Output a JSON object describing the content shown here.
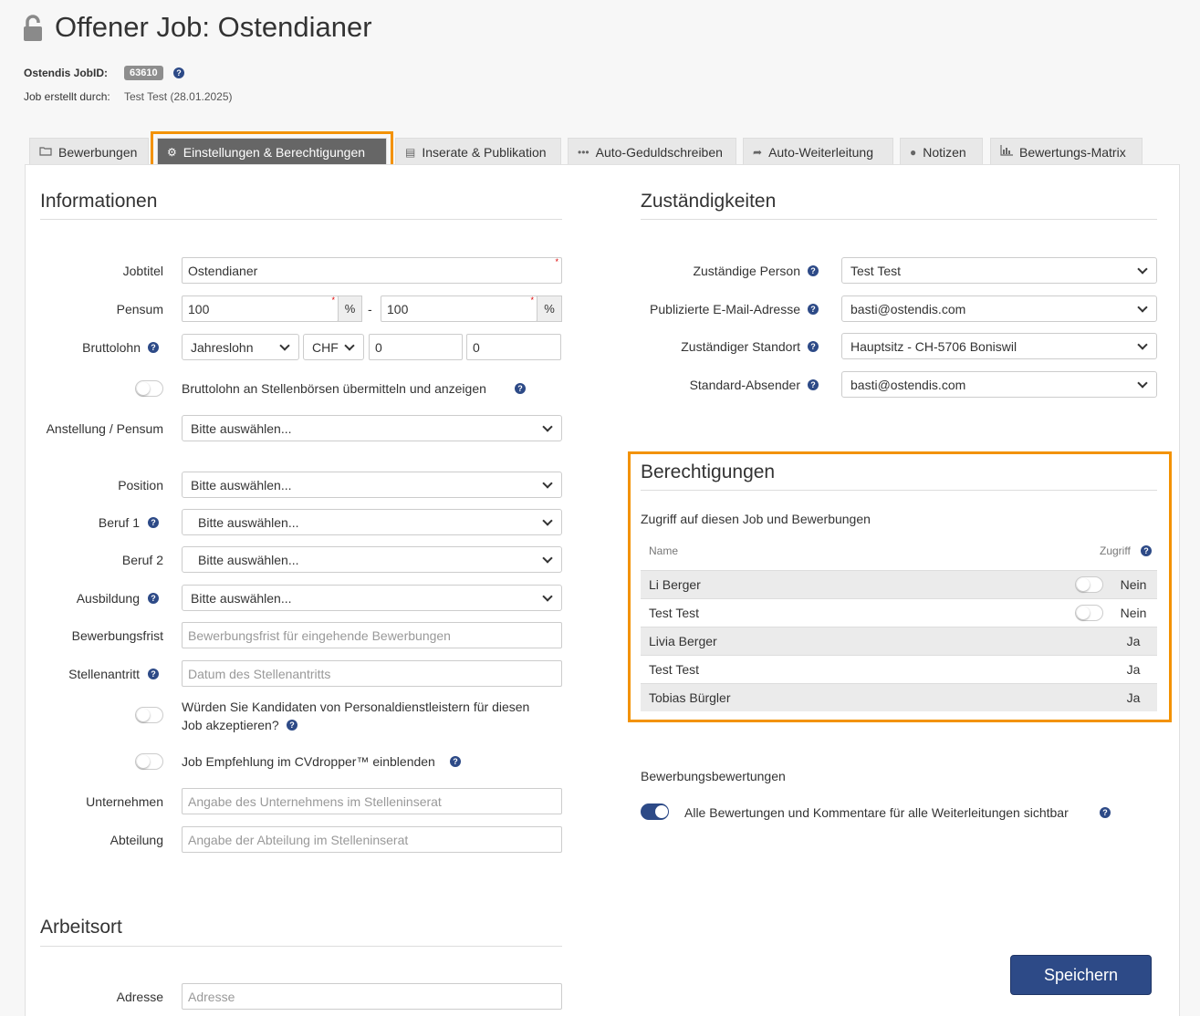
{
  "header": {
    "title": "Offener Job: Ostendianer",
    "jobid_label": "Ostendis JobID:",
    "jobid_value": "63610",
    "created_label": "Job erstellt durch:",
    "created_value": "Test Test (28.01.2025)"
  },
  "tabs": [
    {
      "label": "Bewerbungen",
      "icon": "folder-icon"
    },
    {
      "label": "Einstellungen & Berechtigungen",
      "icon": "gears-icon",
      "active": true
    },
    {
      "label": "Inserate & Publikation",
      "icon": "list-icon"
    },
    {
      "label": "Auto-Geduldschreiben",
      "icon": "dots-icon"
    },
    {
      "label": "Auto-Weiterleitung",
      "icon": "share-icon"
    },
    {
      "label": "Notizen",
      "icon": "comment-icon"
    },
    {
      "label": "Bewertungs-Matrix",
      "icon": "bar-chart-icon"
    }
  ],
  "info": {
    "title": "Informationen",
    "jobtitel_label": "Jobtitel",
    "jobtitel_value": "Ostendianer",
    "pensum_label": "Pensum",
    "pensum_from": "100",
    "pensum_to": "100",
    "percent": "%",
    "dash": "-",
    "brutto_label": "Bruttolohn",
    "brutto_type": "Jahreslohn",
    "brutto_currency": "CHF",
    "brutto_from": "0",
    "brutto_to": "0",
    "brutto_toggle_label": "Bruttolohn an Stellenbörsen übermitteln und anzeigen",
    "anstellung_label": "Anstellung / Pensum",
    "anstellung_value": "Bitte auswählen...",
    "position_label": "Position",
    "position_value": "Bitte auswählen...",
    "beruf1_label": "Beruf 1",
    "beruf1_value": "Bitte auswählen...",
    "beruf2_label": "Beruf 2",
    "beruf2_value": "Bitte auswählen...",
    "ausbildung_label": "Ausbildung",
    "ausbildung_value": "Bitte auswählen...",
    "frist_label": "Bewerbungsfrist",
    "frist_placeholder": "Bewerbungsfrist für eingehende Bewerbungen",
    "antritt_label": "Stellenantritt",
    "antritt_placeholder": "Datum des Stellenantritts",
    "personal_toggle_label_1": "Würden Sie Kandidaten von Personaldienstleistern für diesen",
    "personal_toggle_label_2": "Job akzeptieren?",
    "cvdropper_toggle_label": "Job Empfehlung im CVdropper™ einblenden",
    "unternehmen_label": "Unternehmen",
    "unternehmen_placeholder": "Angabe des Unternehmens im Stelleninserat",
    "abteilung_label": "Abteilung",
    "abteilung_placeholder": "Angabe der Abteilung im Stelleninserat"
  },
  "arbeitsort": {
    "title": "Arbeitsort",
    "adresse_label": "Adresse",
    "adresse_placeholder": "Adresse"
  },
  "zustaendig": {
    "title": "Zuständigkeiten",
    "person_label": "Zuständige Person",
    "person_value": "Test Test",
    "email_label": "Publizierte E-Mail-Adresse",
    "email_value": "basti@ostendis.com",
    "standort_label": "Zuständiger Standort",
    "standort_value": "Hauptsitz - CH-5706 Boniswil",
    "absender_label": "Standard-Absender",
    "absender_value": "basti@ostendis.com"
  },
  "berechtigungen": {
    "title": "Berechtigungen",
    "subtitle": "Zugriff auf diesen Job und Bewerbungen",
    "col_name": "Name",
    "col_access": "Zugriff",
    "rows": [
      {
        "name": "Li Berger",
        "access": "Nein",
        "toggle": true
      },
      {
        "name": "Test Test",
        "access": "Nein",
        "toggle": true
      },
      {
        "name": "Livia Berger",
        "access": "Ja",
        "toggle": false
      },
      {
        "name": "Test Test",
        "access": "Ja",
        "toggle": false
      },
      {
        "name": "Tobias Bürgler",
        "access": "Ja",
        "toggle": false
      }
    ]
  },
  "bewertungen": {
    "title": "Bewerbungsbewertungen",
    "toggle_label": "Alle Bewertungen und Kommentare für alle Weiterleitungen sichtbar"
  },
  "save_label": "Speichern",
  "colors": {
    "accent": "#2d4a87",
    "highlight": "#f39200",
    "active_tab": "#666666"
  }
}
